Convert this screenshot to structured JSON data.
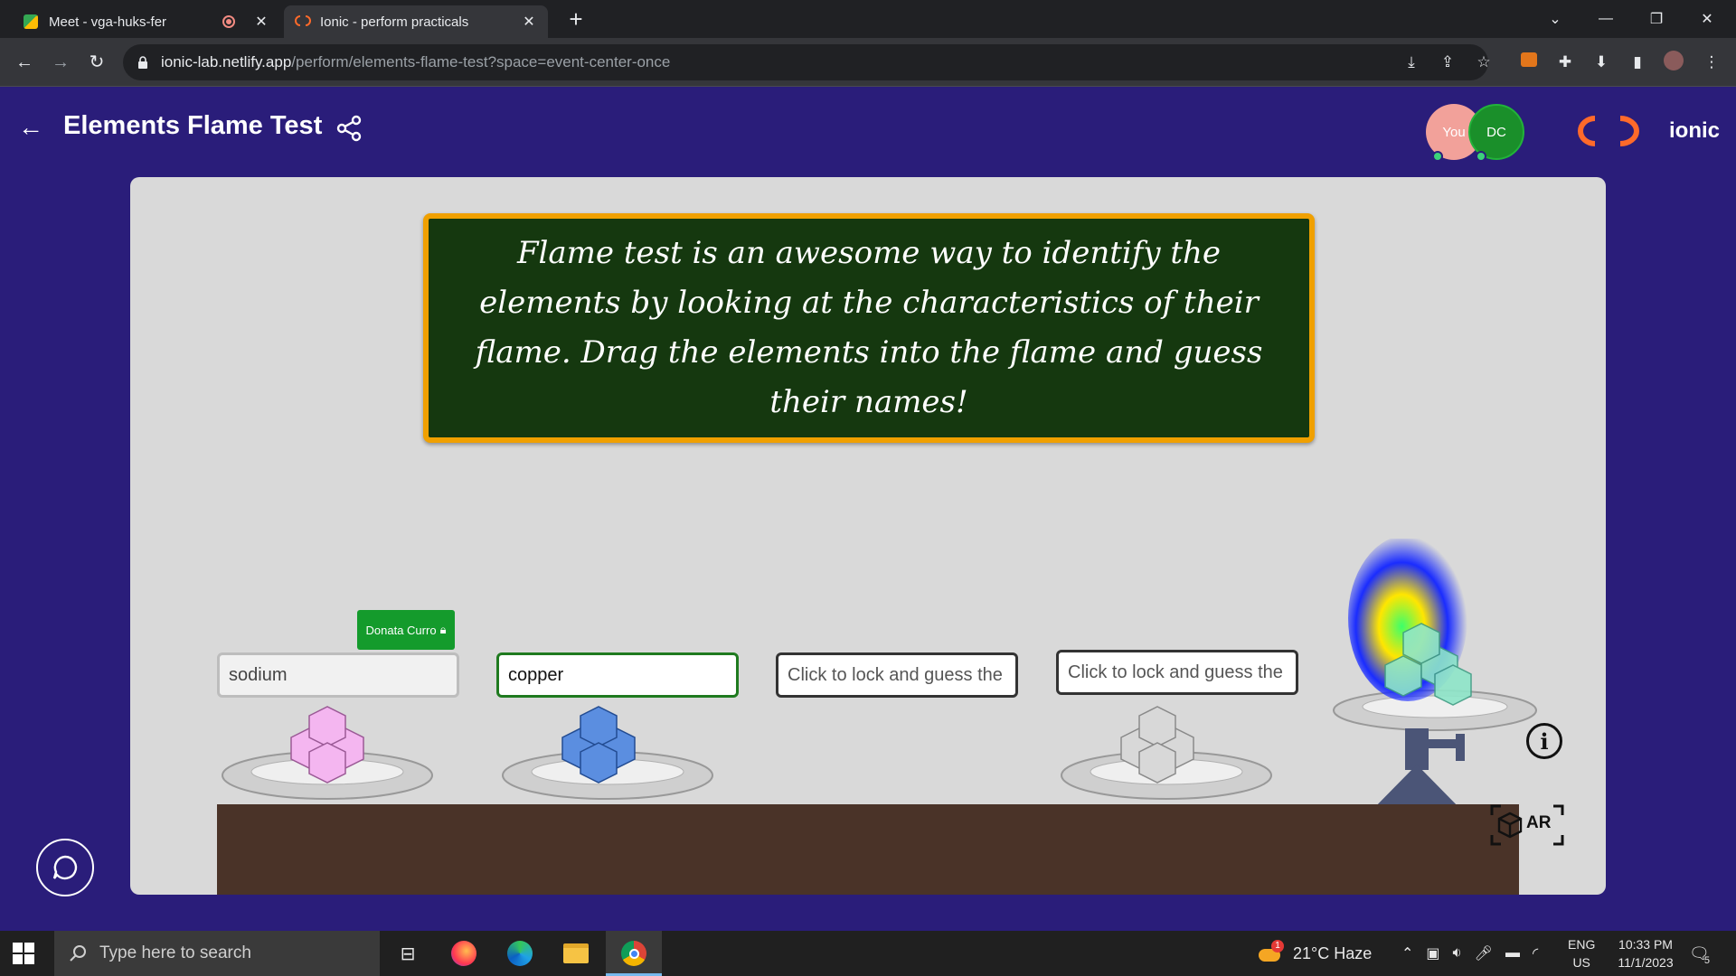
{
  "browser": {
    "tabs": [
      {
        "title": "Meet - vga-huks-fer"
      },
      {
        "title": "Ionic - perform practicals"
      }
    ],
    "url_host": "ionic-lab.netlify.app",
    "url_path": "/perform/elements-flame-test?space=event-center-once"
  },
  "header": {
    "title": "Elements Flame Test",
    "participants": [
      {
        "label": "You",
        "color": "#f2a19a"
      },
      {
        "label": "DC",
        "color": "#1a8f2a"
      }
    ],
    "brand": "ionic"
  },
  "board": {
    "text": "Flame test is an awesome way to identify the elements by looking at the characteristics of their flame. Drag the elements into the flame and guess their names!"
  },
  "samples": [
    {
      "guess": "sodium",
      "locked_by": "Donata Curro",
      "crystal_color": "#f4b6f0"
    },
    {
      "guess": "copper",
      "crystal_color": "#5b8ee0"
    },
    {
      "placeholder": "Click to lock and guess the"
    },
    {
      "placeholder": "Click to lock and guess the",
      "crystal_color": "#d8d8d8"
    }
  ],
  "burner": {
    "flame_colors": [
      "#1a2cff",
      "#ffe600",
      "#3cff6a"
    ],
    "crystal_color": "#8ee6c9"
  },
  "controls": {
    "ar_label": "AR"
  },
  "taskbar": {
    "search_placeholder": "Type here to search",
    "weather": "21°C  Haze",
    "weather_badge": "1",
    "lang1": "ENG",
    "lang2": "US",
    "time": "10:33 PM",
    "date": "11/1/2023",
    "notifications": "5"
  }
}
